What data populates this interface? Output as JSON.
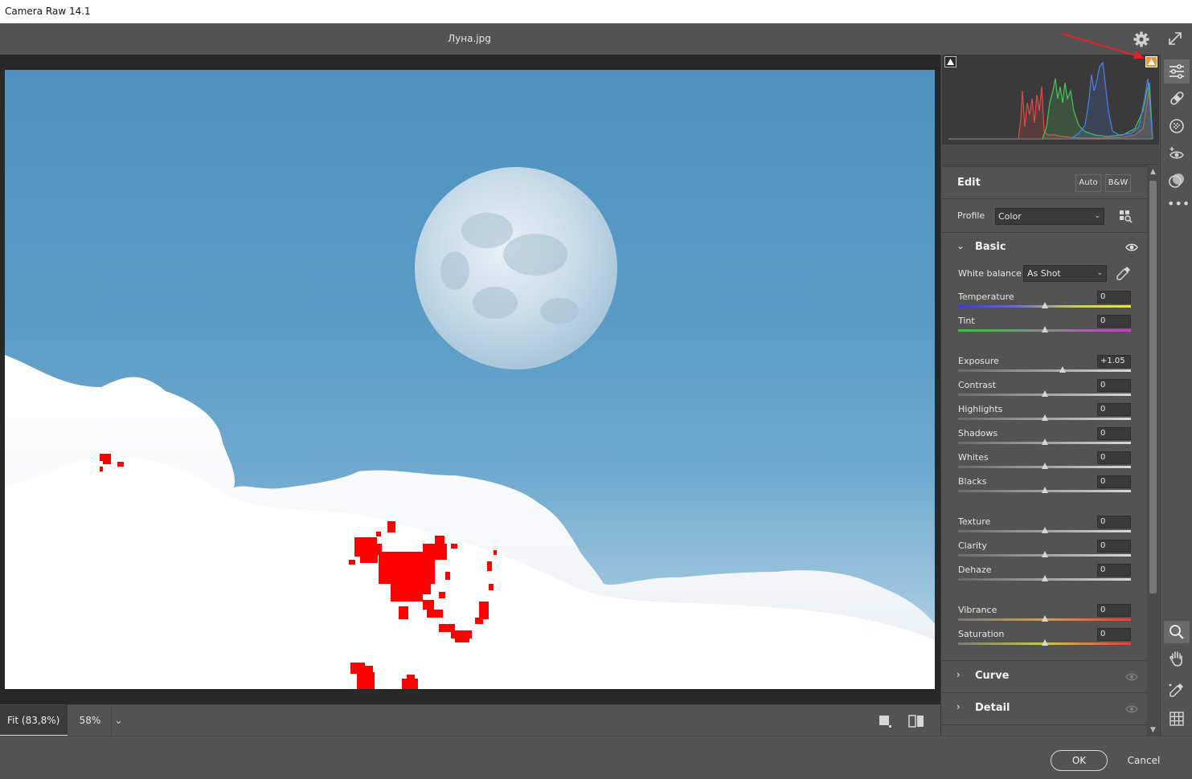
{
  "app": {
    "title": "Camera Raw 14.1"
  },
  "document": {
    "title": "Луна.jpg"
  },
  "panel": {
    "edit_title": "Edit",
    "auto_label": "Auto",
    "bw_label": "B&W",
    "profile_label": "Profile",
    "profile_value": "Color",
    "basic_title": "Basic",
    "wb_label": "White balance",
    "wb_value": "As Shot",
    "sliders": [
      {
        "label": "Temperature",
        "value": "0",
        "position": 0.5
      },
      {
        "label": "Tint",
        "value": "0",
        "position": 0.5
      },
      {
        "label": "Exposure",
        "value": "+1.05",
        "position": 0.605
      },
      {
        "label": "Contrast",
        "value": "0",
        "position": 0.5
      },
      {
        "label": "Highlights",
        "value": "0",
        "position": 0.5
      },
      {
        "label": "Shadows",
        "value": "0",
        "position": 0.5
      },
      {
        "label": "Whites",
        "value": "0",
        "position": 0.5
      },
      {
        "label": "Blacks",
        "value": "0",
        "position": 0.5
      },
      {
        "label": "Texture",
        "value": "0",
        "position": 0.5
      },
      {
        "label": "Clarity",
        "value": "0",
        "position": 0.5
      },
      {
        "label": "Dehaze",
        "value": "0",
        "position": 0.5
      },
      {
        "label": "Vibrance",
        "value": "0",
        "position": 0.5
      },
      {
        "label": "Saturation",
        "value": "0",
        "position": 0.5
      }
    ],
    "curve_title": "Curve",
    "detail_title": "Detail"
  },
  "zoom": {
    "fit_label": "Fit (83,8%)",
    "value": "58%"
  },
  "footer": {
    "ok_label": "OK",
    "cancel_label": "Cancel"
  },
  "colors": {
    "background": "#535353",
    "canvas": "#282828",
    "highlight_clipping": "#ff0000",
    "clip_warning_active": "#e8983b",
    "annotation_arrow": "#e52222"
  },
  "icons": {
    "settings": "gear-icon",
    "fullscreen": "expand-icon",
    "edit_tool": "sliders-icon",
    "heal_tool": "bandage-icon",
    "mask_tool": "mask-icon",
    "redeye_tool": "red-eye-icon",
    "presets_tool": "presets-icon",
    "more_tools": "more-icon",
    "zoom_tool": "magnifier-icon",
    "hand_tool": "hand-icon",
    "sampler_tool": "color-sampler-icon",
    "grid_tool": "grid-icon"
  }
}
